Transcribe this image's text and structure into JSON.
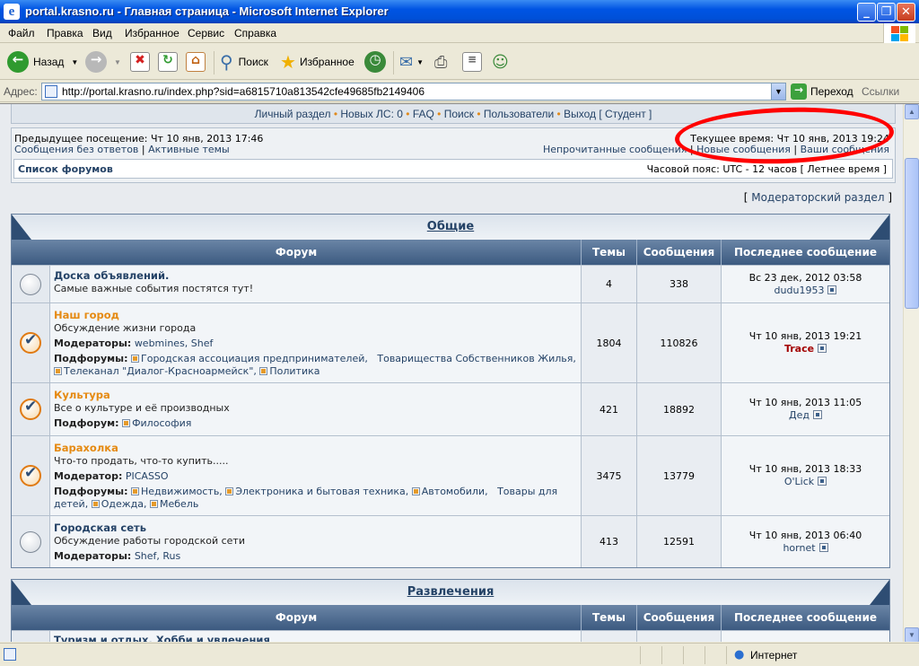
{
  "window": {
    "title": "portal.krasno.ru - Главная страница - Microsoft Internet Explorer",
    "min": "_",
    "max": "❐",
    "close": "✕"
  },
  "menu": [
    "Файл",
    "Правка",
    "Вид",
    "Избранное",
    "Сервис",
    "Справка"
  ],
  "toolbar": {
    "back": "Назад",
    "search": "Поиск",
    "favorites": "Избранное"
  },
  "address": {
    "label": "Адрес:",
    "url": "http://portal.krasno.ru/index.php?sid=a6815710a813542cfe49685fb2149406",
    "go": "Переход",
    "links": "Ссылки"
  },
  "nav": {
    "items": [
      "Личный раздел",
      "Новых ЛС: 0",
      "FAQ",
      "Поиск",
      "Пользователи",
      "Выход [ Студент ]"
    ]
  },
  "info": {
    "prev_visit": "Предыдущее посещение: Чт 10 янв, 2013 17:46",
    "unanswered": "Сообщения без ответов",
    "active": "Активные темы",
    "current_time": "Текущее время: Чт 10 янв, 2013 19:24",
    "unread": "Непрочитанные сообщения",
    "new_posts": "Новые сообщения",
    "your_posts": "Ваши сообщения",
    "forum_list": "Список форумов",
    "timezone": "Часовой пояс: UTC - 12 часов [ Летнее время ]",
    "mod_section": "Модераторский раздел"
  },
  "columns": {
    "forum": "Форум",
    "topics": "Темы",
    "posts": "Сообщения",
    "last": "Последнее сообщение"
  },
  "categories": [
    {
      "title": "Общие",
      "forums": [
        {
          "name": "Доска объявлений.",
          "desc": "Самые важные события постятся тут!",
          "topics": "4",
          "posts": "338",
          "last_date": "Вс 23 дек, 2012 03:58",
          "last_user": "dudu1953"
        },
        {
          "name": "Наш город",
          "desc": "Обсуждение жизни города",
          "mods_label": "Модераторы:",
          "mods": "webmines, Shef",
          "sub_label": "Подфорумы:",
          "subs": [
            "Городская ассоциация предпринимателей,",
            "Товарищества Собственников Жилья,",
            "Телеканал \"Диалог-Красноармейск\",",
            "Политика"
          ],
          "topics": "1804",
          "posts": "110826",
          "last_date": "Чт 10 янв, 2013 19:21",
          "last_user": "Trace"
        },
        {
          "name": "Культура",
          "desc": "Все о культуре и её производных",
          "sub_label": "Подфорум:",
          "subs": [
            "Философия"
          ],
          "topics": "421",
          "posts": "18892",
          "last_date": "Чт 10 янв, 2013 11:05",
          "last_user": "Дед"
        },
        {
          "name": "Барахолка",
          "desc": "Что-то продать, что-то купить.....",
          "mods_label": "Модератор:",
          "mods": "PICASSO",
          "sub_label": "Подфорумы:",
          "subs": [
            "Недвижимость,",
            "Электроника и бытовая техника,",
            "Автомобили,",
            "Товары для детей,",
            "Одежда,",
            "Мебель"
          ],
          "topics": "3475",
          "posts": "13779",
          "last_date": "Чт 10 янв, 2013 18:33",
          "last_user": "O'Lick"
        },
        {
          "name": "Городская сеть",
          "desc": "Обсуждение работы городской сети",
          "mods_label": "Модераторы:",
          "mods": "Shef, Rus",
          "topics": "413",
          "posts": "12591",
          "last_date": "Чт 10 янв, 2013 06:40",
          "last_user": "hornet"
        }
      ]
    },
    {
      "title": "Развлечения",
      "forums": [
        {
          "name": "Туризм и отдых. Хобби и увлечения"
        }
      ]
    }
  ],
  "status": {
    "zone": "Интернет"
  }
}
